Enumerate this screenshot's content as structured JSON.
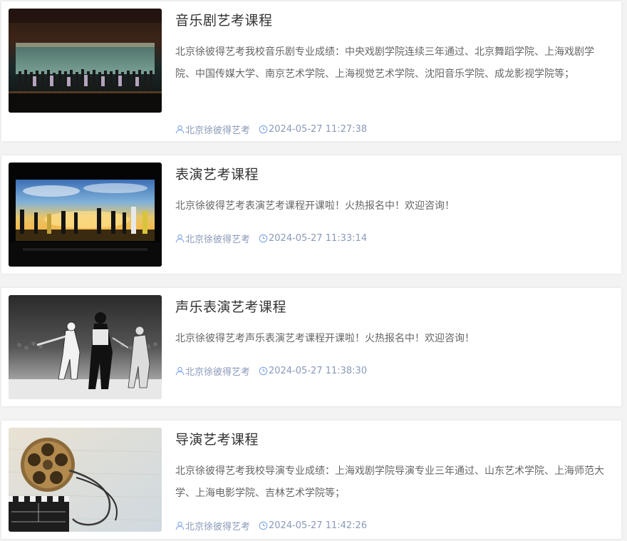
{
  "colors": {
    "title": "#333333",
    "desc": "#666666",
    "meta": "#8a9ab8",
    "icon": "#7fa7e6"
  },
  "articles": [
    {
      "title": "音乐剧艺考课程",
      "description": "北京徐彼得艺考我校音乐剧专业成绩：中央戏剧学院连续三年通过、北京舞蹈学院、上海戏剧学院、中国传媒大学、南京艺术学院、上海视觉艺术学院、沈阳音乐学院、成龙影视学院等；",
      "author": "北京徐彼得艺考",
      "time": "2024-05-27 11:27:38",
      "image": "stage-curtain-call-photo"
    },
    {
      "title": "表演艺考课程",
      "description": "北京徐彼得艺考表演艺考课程开课啦！火热报名中！欢迎咨询！",
      "author": "北京徐彼得艺考",
      "time": "2024-05-27 11:33:14",
      "image": "stage-sunset-backdrop-photo"
    },
    {
      "title": "声乐表演艺考课程",
      "description": "北京徐彼得艺考声乐表演艺考课程开课啦！火热报名中！欢迎咨询！",
      "author": "北京徐彼得艺考",
      "time": "2024-05-27 11:38:30",
      "image": "concert-performers-bw-photo"
    },
    {
      "title": "导演艺考课程",
      "description": "北京徐彼得艺考我校导演专业成绩：上海戏剧学院导演专业三年通过、山东艺术学院、上海师范大学、上海电影学院、吉林艺术学院等；",
      "author": "北京徐彼得艺考",
      "time": "2024-05-27 11:42:26",
      "image": "film-reel-clapperboard-photo"
    }
  ]
}
